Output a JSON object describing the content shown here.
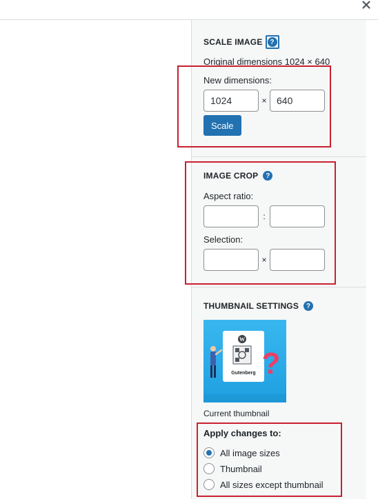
{
  "scale_image": {
    "heading": "SCALE IMAGE",
    "help_glyph": "?",
    "original_dimensions": "Original dimensions 1024 × 640",
    "new_dimensions_label": "New dimensions:",
    "width_value": "1024",
    "height_value": "640",
    "separator": "×",
    "scale_button": "Scale"
  },
  "image_crop": {
    "heading": "IMAGE CROP",
    "help_glyph": "?",
    "aspect_ratio_label": "Aspect ratio:",
    "aspect_separator": ":",
    "selection_label": "Selection:",
    "selection_separator": "×"
  },
  "thumbnail_settings": {
    "heading": "THUMBNAIL SETTINGS",
    "help_glyph": "?",
    "current_thumbnail_label": "Current thumbnail",
    "thumbnail_caption": "Gutenberg",
    "apply_changes_label": "Apply changes to:",
    "options": [
      {
        "label": "All image sizes",
        "checked": true
      },
      {
        "label": "Thumbnail",
        "checked": false
      },
      {
        "label": "All sizes except thumbnail",
        "checked": false
      }
    ]
  },
  "colors": {
    "accent": "#2271b1",
    "annotation_red": "#c8202f",
    "sidebar_bg": "#f6f7f7"
  },
  "icons": {
    "close": "close-icon",
    "help": "help-icon"
  }
}
